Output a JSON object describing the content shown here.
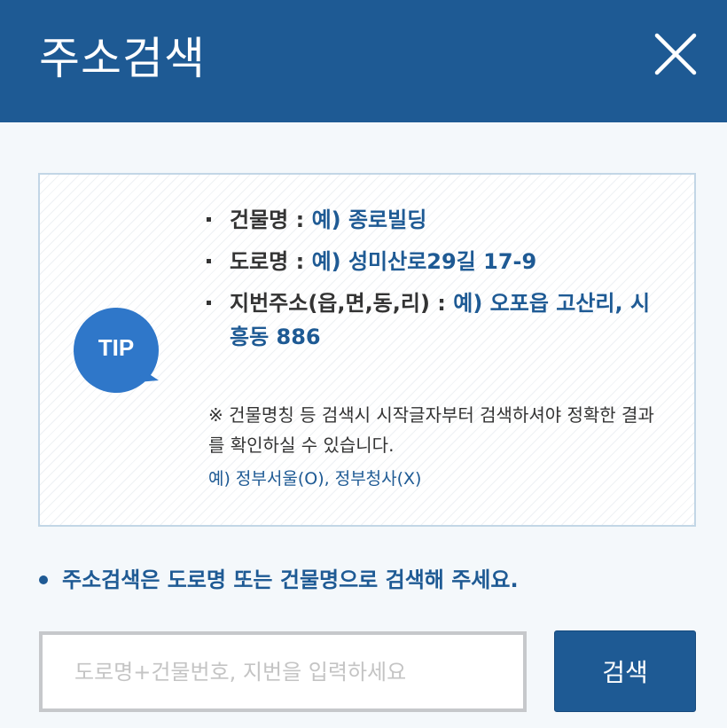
{
  "header": {
    "title": "주소검색",
    "close_icon": "close-icon"
  },
  "tip": {
    "badge": "TIP",
    "items": [
      {
        "label": "건물명 : ",
        "example": "예) 종로빌딩"
      },
      {
        "label": "도로명 : ",
        "example": "예) 성미산로29길 17-9"
      },
      {
        "label": "지번주소(읍,면,동,리) : ",
        "example": "예) 오포읍 고산리, 시흥동 886"
      }
    ],
    "note": "※ 건물명칭 등 검색시 시작글자부터 검색하셔야 정확한 결과를 확인하실 수 있습니다.",
    "example": "예) 정부서울(O), 정부청사(X)"
  },
  "notice": "주소검색은 도로명 또는 건물명으로 검색해 주세요.",
  "search": {
    "placeholder": "도로명+건물번호, 지번을 입력하세요",
    "value": "",
    "button_label": "검색"
  },
  "colors": {
    "brand": "#1e5a94",
    "tip_bubble": "#2f77c9",
    "background": "#f4f8fb"
  }
}
